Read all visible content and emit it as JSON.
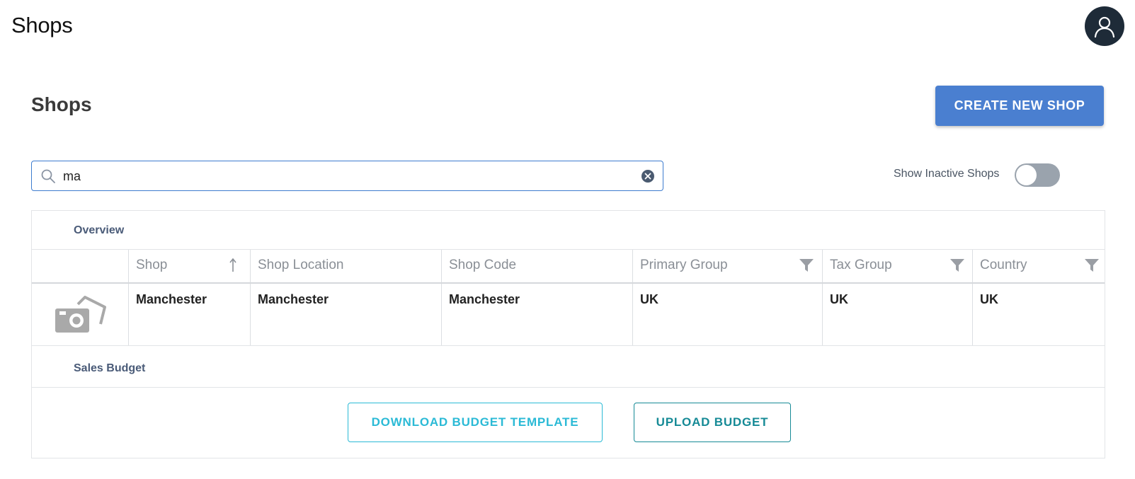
{
  "header": {
    "app_title": "Shops"
  },
  "page": {
    "title": "Shops",
    "create_button_label": "CREATE NEW SHOP"
  },
  "search": {
    "value": "ma",
    "placeholder": ""
  },
  "filters": {
    "show_inactive_label": "Show Inactive Shops",
    "show_inactive_on": false
  },
  "overview": {
    "section_label": "Overview",
    "columns": [
      "Shop",
      "Shop Location",
      "Shop Code",
      "Primary Group",
      "Tax Group",
      "Country"
    ],
    "rows": [
      {
        "image": "camera-placeholder-icon",
        "shop": "Manchester",
        "location": "Manchester",
        "code": "Manchester",
        "primary_group": "UK",
        "tax_group": "UK",
        "country": "UK"
      }
    ]
  },
  "sales_budget": {
    "section_label": "Sales Budget",
    "download_label": "DOWNLOAD BUDGET TEMPLATE",
    "upload_label": "UPLOAD BUDGET"
  },
  "colors": {
    "primary": "#4a7fd0",
    "avatar_bg": "#1e2b38",
    "download_accent": "#2bbad6",
    "upload_accent": "#168a96",
    "toggle_off": "#9aa3ad"
  }
}
